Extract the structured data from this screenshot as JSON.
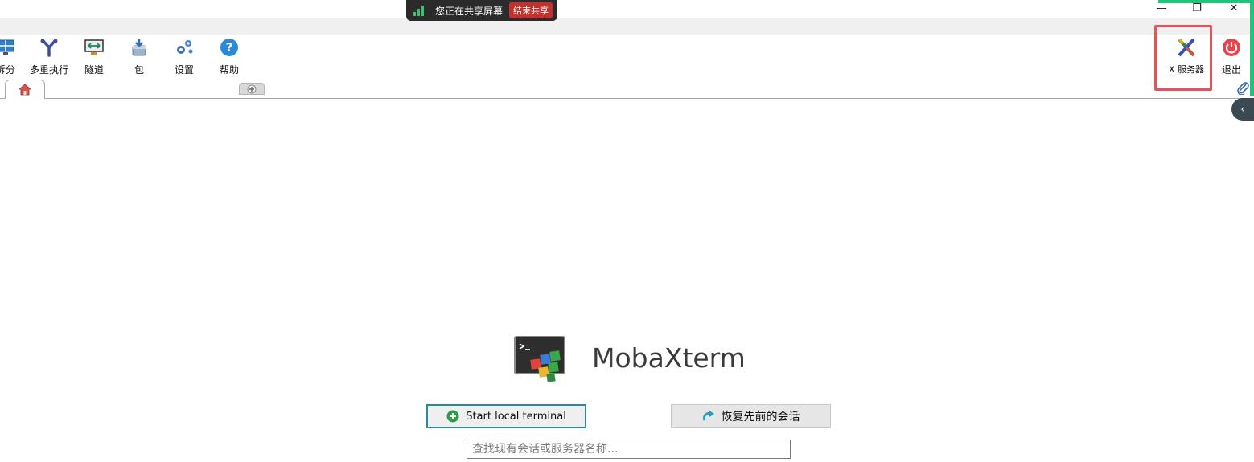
{
  "screen_share": {
    "status_text": "您正在共享屏幕",
    "stop_label": "结束共享"
  },
  "window_controls": {
    "minimize": "—",
    "restore": "❐",
    "close": "✕"
  },
  "toolbar": {
    "items": [
      {
        "label": "拆分",
        "icon": "split-icon"
      },
      {
        "label": "多重执行",
        "icon": "multiexec-icon"
      },
      {
        "label": "隧道",
        "icon": "tunnel-icon"
      },
      {
        "label": "包",
        "icon": "package-icon"
      },
      {
        "label": "设置",
        "icon": "settings-gear-icon"
      },
      {
        "label": "帮助",
        "icon": "help-icon"
      }
    ],
    "xserver_label": "X 服务器",
    "exit_label": "退出"
  },
  "tabs": {
    "home_icon": "home-icon",
    "new_tab_icon": "plus-icon",
    "collapse_glyph": "‹"
  },
  "main": {
    "app_name": "MobaXterm",
    "start_terminal_label": "Start local terminal",
    "restore_session_label": "恢复先前的会话",
    "search_placeholder": "查找现有会话或服务器名称..."
  },
  "colors": {
    "accent_teal": "#2a8a9c",
    "highlight_red": "#e0555c",
    "share_green": "#1fc47a",
    "exit_red": "#e8424a"
  }
}
